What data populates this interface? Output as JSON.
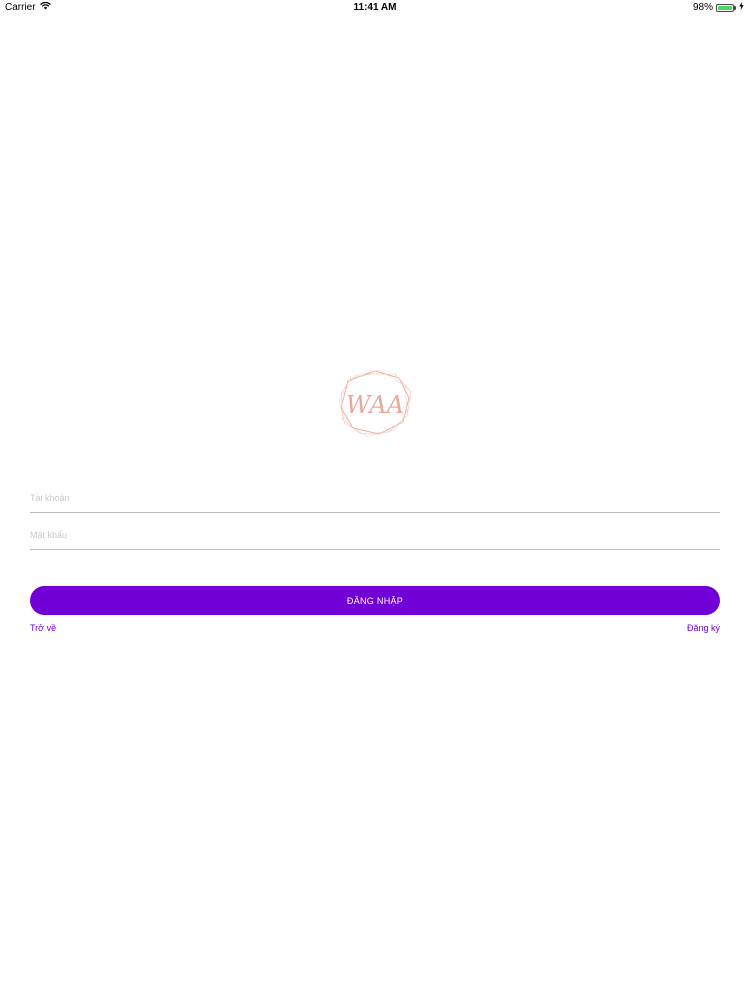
{
  "status_bar": {
    "carrier": "Carrier",
    "time": "11:41 AM",
    "battery_percent": "98%",
    "battery_level": 0.98
  },
  "logo": {
    "text": "WAA",
    "color": "#e8aa9a"
  },
  "form": {
    "username_placeholder": "Tài khoản",
    "password_placeholder": "Mật khẩu",
    "login_label": "ĐĂNG NHẬP"
  },
  "links": {
    "back_label": "Trở về",
    "register_label": "Đăng ký"
  },
  "colors": {
    "accent": "#7000d6",
    "battery": "#4cd964"
  }
}
